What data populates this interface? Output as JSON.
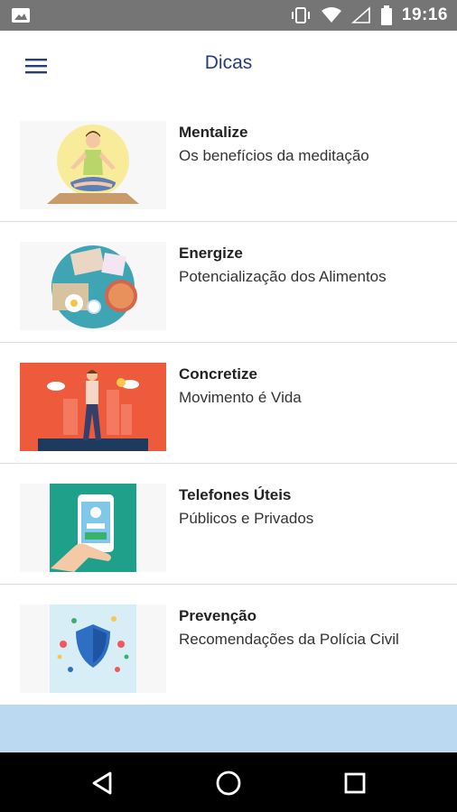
{
  "status_bar": {
    "time": "19:16"
  },
  "app_bar": {
    "title": "Dicas"
  },
  "items": [
    {
      "title": "Mentalize",
      "subtitle": "Os benefícios da meditação",
      "icon": "meditation-image"
    },
    {
      "title": "Energize",
      "subtitle": "Potencialização dos Alimentos",
      "icon": "food-image"
    },
    {
      "title": "Concretize",
      "subtitle": "Movimento é Vida",
      "icon": "exercise-image"
    },
    {
      "title": "Telefones Úteis",
      "subtitle": "Públicos e Privados",
      "icon": "phone-image"
    },
    {
      "title": "Prevenção",
      "subtitle": "Recomendações da Polícia Civil",
      "icon": "shield-image"
    }
  ],
  "colors": {
    "status_bar": "#757575",
    "title": "#283b7a",
    "bottom_band": "#bcd9f2",
    "nav_bar": "#000000"
  }
}
